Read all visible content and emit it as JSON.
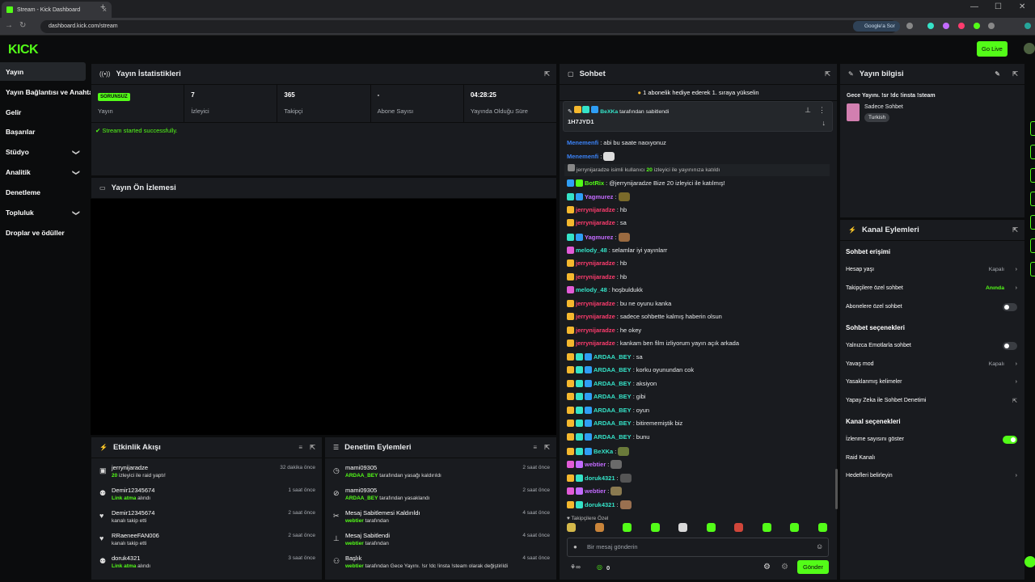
{
  "browser": {
    "tab_title": "Stream - Kick Dashboard",
    "new_tab": "+",
    "url": "dashboard.kick.com/stream",
    "google_btn": "Google'a Sor",
    "win_min": "—",
    "win_max": "☐",
    "win_close": "✕"
  },
  "topbar": {
    "logo": "KICK",
    "go_live": "Go Live"
  },
  "sidebar": {
    "items": [
      {
        "label": "Yayın",
        "active": true
      },
      {
        "label": "Yayın Bağlantısı ve Anahtar"
      },
      {
        "label": "Gelir"
      },
      {
        "label": "Başarılar"
      },
      {
        "label": "Stüdyo",
        "chevron": "❯"
      },
      {
        "label": "Analitik",
        "chevron": "❯"
      },
      {
        "label": "Denetleme"
      },
      {
        "label": "Topluluk",
        "chevron": "❯"
      },
      {
        "label": "Droplar ve ödüller"
      }
    ]
  },
  "stats": {
    "title": "Yayın İstatistikleri",
    "badge": "SORUNSUZ",
    "stream_label": "Yayın",
    "viewers": "7",
    "viewers_label": "İzleyici",
    "followers": "365",
    "followers_label": "Takipçi",
    "subs": "-",
    "subs_label": "Abone Sayısı",
    "uptime": "04:28:25",
    "uptime_label": "Yayında Olduğu Süre",
    "status_msg": "Stream started successfully."
  },
  "preview": {
    "title": "Yayın Ön İzlemesi"
  },
  "activity": {
    "title": "Etkinlik Akışı",
    "items": [
      {
        "name": "jerrynijaradze",
        "pre": "20",
        "detail": " izleyici ile raid yaptı!",
        "time": "32 dakika önce",
        "icon": "▣"
      },
      {
        "name": "Demir12345674",
        "pre": "Link atma",
        "detail": " alındı",
        "time": "1 saat önce",
        "icon": "⚉"
      },
      {
        "name": "Demir12345674",
        "pre": "",
        "detail": "kanalı takip etti",
        "time": "2 saat önce",
        "icon": "♥"
      },
      {
        "name": "RRaeneeFAN006",
        "pre": "",
        "detail": "kanalı takip etti",
        "time": "2 saat önce",
        "icon": "♥"
      },
      {
        "name": "doruk4321",
        "pre": "Link atma",
        "detail": " alındı",
        "time": "3 saat önce",
        "icon": "⚉"
      }
    ]
  },
  "moderation": {
    "title": "Denetim Eylemleri",
    "items": [
      {
        "name": "mami09305",
        "pre": "ARDAA_BEY",
        "detail": " tarafından yasağı kaldırıldı",
        "time": "2 saat önce",
        "icon": "◷"
      },
      {
        "name": "mami09305",
        "pre": "ARDAA_BEY",
        "detail": " tarafından yasaklandı",
        "time": "2 saat önce",
        "icon": "⊘"
      },
      {
        "name": "Mesaj Sabitlemesi Kaldırıldı",
        "pre": "webtier",
        "detail": " tarafından",
        "time": "4 saat önce",
        "icon": "✂"
      },
      {
        "name": "Mesaj Sabitlendi",
        "pre": "webtier",
        "detail": " tarafından",
        "time": "4 saat önce",
        "icon": "⊥"
      },
      {
        "name": "Başlık",
        "pre": "webtier",
        "detail": " tarafından Gece Yayını. !sr !dc !insta !steam olarak değiştirildi",
        "time": "4 saat önce",
        "icon": "⚇"
      }
    ]
  },
  "chat": {
    "title": "Sohbet",
    "banner": "1 abonelik hediye ederek 1. sıraya yükselin",
    "pinned_by": "BeXKa",
    "pinned_by_text": "tarafından sabitlendi",
    "pinned_msg": "1H7JYD1",
    "system_name": "jerrynijaradze",
    "system_pre": " isimli kullanıcı ",
    "system_count": "20",
    "system_post": " izleyici ile yayınınıza katıldı",
    "messages": [
      {
        "user": "Menemenfi",
        "color": "#3b82f6",
        "text": "abi bu saate naoıyonuz",
        "badges": []
      },
      {
        "user": "Menemenfi",
        "color": "#3b82f6",
        "text": "",
        "emote": "#ddd",
        "badges": []
      },
      {
        "user": "BotRix",
        "color": "#53fc18",
        "text": "@jerrynijaradze Bize 20 izleyici ile katılmış!",
        "badges": [
          "#2f9ef5",
          "#53fc18"
        ]
      },
      {
        "user": "Yagmurez",
        "color": "#c36bff",
        "text": "",
        "emote": "#7a6a2a",
        "badges": [
          "#35e3c8",
          "#2f9ef5"
        ]
      },
      {
        "user": "jerrynijaradze",
        "color": "#ff3c6e",
        "text": "hb",
        "badges": [
          "#f5b82e"
        ]
      },
      {
        "user": "jerrynijaradze",
        "color": "#ff3c6e",
        "text": "sa",
        "badges": [
          "#f5b82e"
        ]
      },
      {
        "user": "Yagmurez",
        "color": "#c36bff",
        "text": "",
        "emote": "#9a6a40",
        "badges": [
          "#35e3c8",
          "#2f9ef5"
        ]
      },
      {
        "user": "melody_48",
        "color": "#35e3c8",
        "text": "selamlar iyi yayınlarr",
        "badges": [
          "#e25bd7"
        ]
      },
      {
        "user": "jerrynijaradze",
        "color": "#ff3c6e",
        "text": "hb",
        "badges": [
          "#f5b82e"
        ]
      },
      {
        "user": "jerrynijaradze",
        "color": "#ff3c6e",
        "text": "hb",
        "badges": [
          "#f5b82e"
        ]
      },
      {
        "user": "melody_48",
        "color": "#35e3c8",
        "text": "hoşbuldukk",
        "badges": [
          "#e25bd7"
        ]
      },
      {
        "user": "jerrynijaradze",
        "color": "#ff3c6e",
        "text": "bu ne oyunu kanka",
        "badges": [
          "#f5b82e"
        ]
      },
      {
        "user": "jerrynijaradze",
        "color": "#ff3c6e",
        "text": "sadece sohbette kalmış haberin olsun",
        "badges": [
          "#f5b82e"
        ]
      },
      {
        "user": "jerrynijaradze",
        "color": "#ff3c6e",
        "text": "he okey",
        "badges": [
          "#f5b82e"
        ]
      },
      {
        "user": "jerrynijaradze",
        "color": "#ff3c6e",
        "text": "kankam ben film izliyorum yayın açık arkada",
        "badges": [
          "#f5b82e"
        ]
      },
      {
        "user": "ARDAA_BEY",
        "color": "#35e3c8",
        "text": "sa",
        "badges": [
          "#f5b82e",
          "#35e3c8",
          "#2f9ef5"
        ]
      },
      {
        "user": "ARDAA_BEY",
        "color": "#35e3c8",
        "text": "korku oyunundan cok",
        "badges": [
          "#f5b82e",
          "#35e3c8",
          "#2f9ef5"
        ]
      },
      {
        "user": "ARDAA_BEY",
        "color": "#35e3c8",
        "text": "aksiyon",
        "badges": [
          "#f5b82e",
          "#35e3c8",
          "#2f9ef5"
        ]
      },
      {
        "user": "ARDAA_BEY",
        "color": "#35e3c8",
        "text": "gibi",
        "badges": [
          "#f5b82e",
          "#35e3c8",
          "#2f9ef5"
        ]
      },
      {
        "user": "ARDAA_BEY",
        "color": "#35e3c8",
        "text": "oyun",
        "badges": [
          "#f5b82e",
          "#35e3c8",
          "#2f9ef5"
        ]
      },
      {
        "user": "ARDAA_BEY",
        "color": "#35e3c8",
        "text": "bitirememiştik biz",
        "badges": [
          "#f5b82e",
          "#35e3c8",
          "#2f9ef5"
        ]
      },
      {
        "user": "ARDAA_BEY",
        "color": "#35e3c8",
        "text": "bunu",
        "badges": [
          "#f5b82e",
          "#35e3c8",
          "#2f9ef5"
        ]
      },
      {
        "user": "BeXKa",
        "color": "#35e3c8",
        "text": "",
        "emote": "#6a7a3a",
        "badges": [
          "#f5b82e",
          "#35e3c8",
          "#2f9ef5"
        ]
      },
      {
        "user": "webtier",
        "color": "#c36bff",
        "text": "",
        "emote": "#6a6a6a",
        "badges": [
          "#e25bd7",
          "#c36bff"
        ]
      },
      {
        "user": "doruk4321",
        "color": "#35e3c8",
        "text": "",
        "emote": "#555",
        "badges": [
          "#f5b82e",
          "#35e3c8"
        ]
      },
      {
        "user": "webtier",
        "color": "#c36bff",
        "text": "",
        "emote": "#8a7a50",
        "badges": [
          "#e25bd7",
          "#c36bff"
        ]
      },
      {
        "user": "doruk4321",
        "color": "#35e3c8",
        "text": "",
        "emote": "#9a7050",
        "badges": [
          "#f5b82e",
          "#35e3c8"
        ]
      }
    ],
    "followers_only": "♥ Takipçilere Özel",
    "input_placeholder": "Bir mesaj gönderin",
    "points": "0",
    "send": "Gönder"
  },
  "info": {
    "title": "Yayın bilgisi",
    "stream_title": "Gece Yayını. !sr !dc !insta !steam",
    "category": "Sadece Sohbet",
    "tag": "Turkish"
  },
  "channel": {
    "title": "Kanal Eylemleri",
    "chat_access": "Sohbet erişimi",
    "account_age": "Hesap yaşı",
    "account_age_val": "Kapalı",
    "followers_chat": "Takipçilere özel sohbet",
    "followers_chat_val": "Anında",
    "subs_chat": "Abonelere özel sohbet",
    "chat_options": "Sohbet seçenekleri",
    "emote_only": "Yalnızca Emotlarla sohbet",
    "slow_mode": "Yavaş mod",
    "slow_mode_val": "Kapalı",
    "banned_words": "Yasaklanmış kelimeler",
    "ai_mod": "Yapay Zeka ile Sohbet Denetimi",
    "channel_options": "Kanal seçenekleri",
    "show_viewers": "İzlenme sayısını göster",
    "raid_channel": "Raid Kanalı",
    "goals": "Hedefleri belirleyin"
  }
}
